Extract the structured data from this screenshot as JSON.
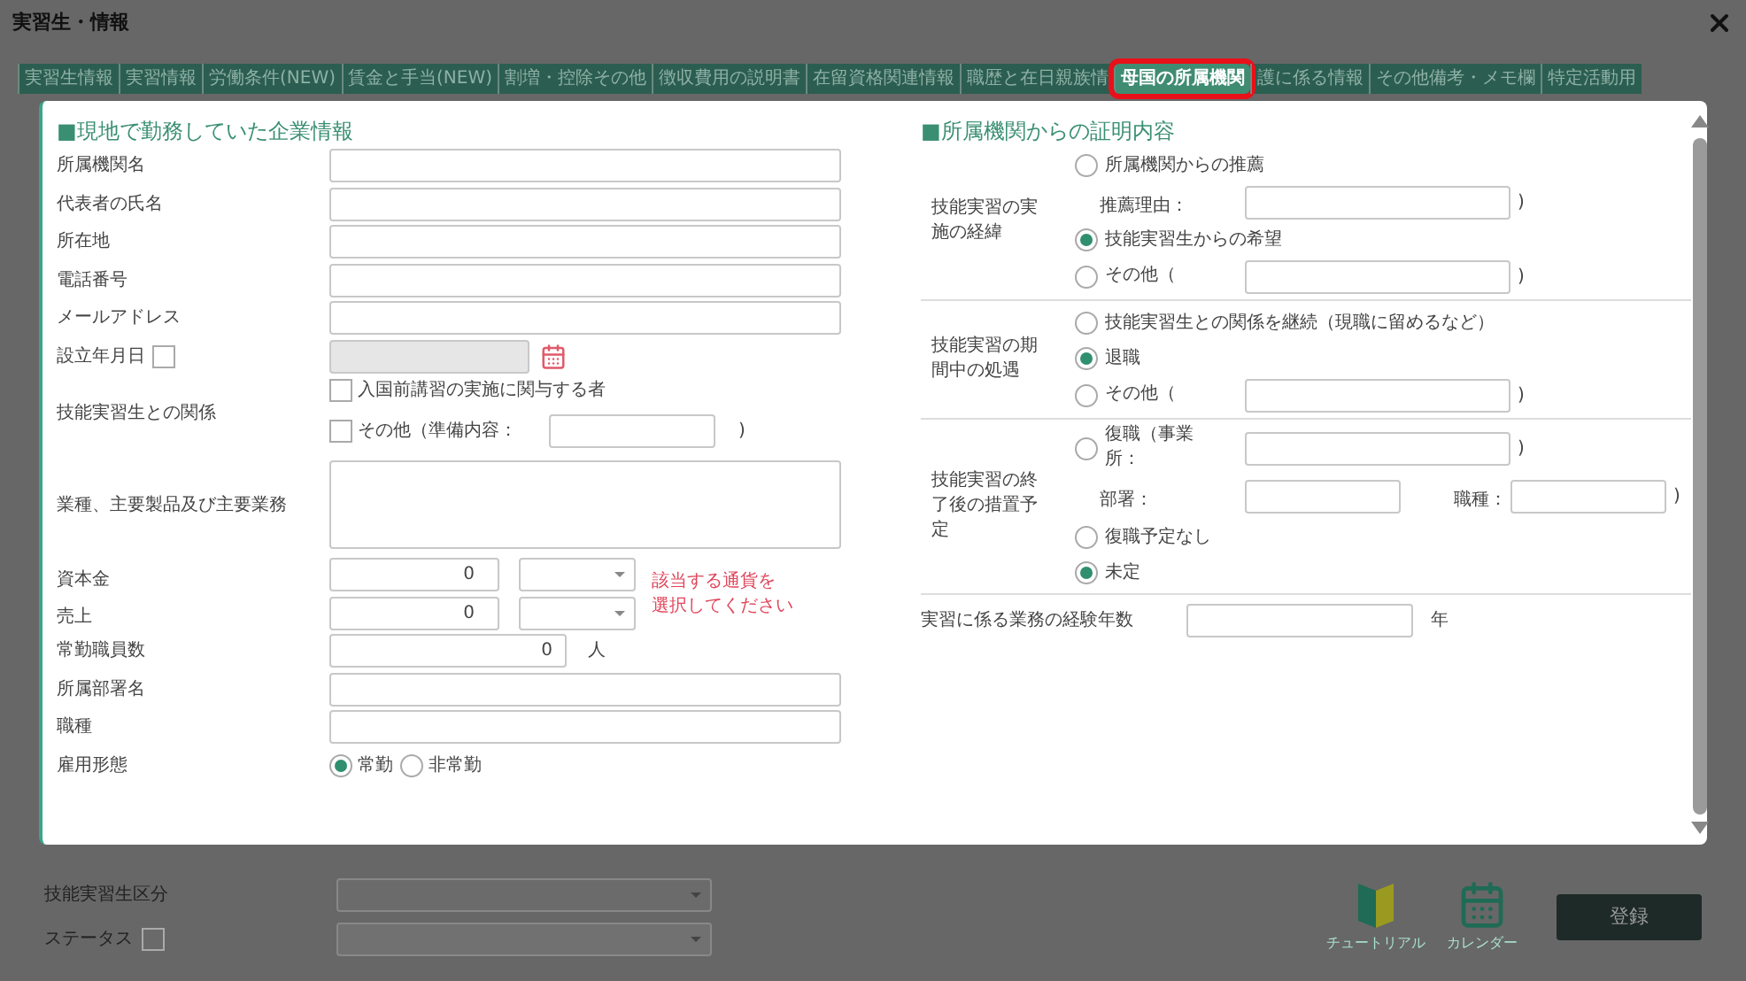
{
  "window": {
    "title": "実習生・情報"
  },
  "tabs": [
    {
      "label": "実習生情報",
      "selected": false
    },
    {
      "label": "実習情報",
      "selected": false
    },
    {
      "label": "労働条件(NEW)",
      "selected": false
    },
    {
      "label": "賃金と手当(NEW)",
      "selected": false
    },
    {
      "label": "割増・控除その他",
      "selected": false
    },
    {
      "label": "徴収費用の説明書",
      "selected": false
    },
    {
      "label": "在留資格関連情報",
      "selected": false
    },
    {
      "label": "職歴と在日親族情",
      "selected": false
    },
    {
      "label": "母国の所属機関",
      "selected": true
    },
    {
      "label": "護に係る情報",
      "selected": false
    },
    {
      "label": "その他備考・メモ欄",
      "selected": false
    },
    {
      "label": "特定活動用",
      "selected": false
    }
  ],
  "company": {
    "heading": "■現地で勤務していた企業情報",
    "rows": [
      {
        "kind": "text",
        "label": "所属機関名"
      },
      {
        "kind": "text",
        "label": "代表者の氏名"
      },
      {
        "kind": "text",
        "label": "所在地"
      },
      {
        "kind": "text",
        "label": "電話番号"
      },
      {
        "kind": "text",
        "label": "メールアドレス"
      },
      {
        "kind": "date",
        "label": "設立年月日",
        "checked": false
      },
      {
        "kind": "relation",
        "label": "技能実習生との関係",
        "options": [
          {
            "label": "入国前講習の実施に関与する者",
            "checked": false
          },
          {
            "label": "その他（準備内容：",
            "checked": false,
            "close": ")"
          }
        ]
      },
      {
        "kind": "textarea",
        "label": "業種、主要製品及び主要業務"
      },
      {
        "kind": "currency",
        "rows": [
          {
            "label": "資本金",
            "value": "0"
          },
          {
            "label": "売上",
            "value": "0"
          }
        ],
        "hint": [
          "該当する通貨を",
          "選択してください"
        ]
      },
      {
        "kind": "count",
        "label": "常勤職員数",
        "value": "0",
        "unit": "人"
      },
      {
        "kind": "text",
        "label": "所属部署名"
      },
      {
        "kind": "text",
        "label": "職種"
      },
      {
        "kind": "radio",
        "label": "雇用形態",
        "options": [
          {
            "label": "常勤",
            "selected": true
          },
          {
            "label": "非常勤",
            "selected": false
          }
        ]
      }
    ]
  },
  "certification": {
    "heading": "■所属機関からの証明内容",
    "groups": [
      {
        "label": "技能実習の実施の経緯",
        "items": [
          {
            "kind": "radio",
            "label": "所属機関からの推薦",
            "selected": false
          },
          {
            "kind": "field",
            "label": "推薦理由：",
            "close": ")"
          },
          {
            "kind": "radio",
            "label": "技能実習生からの希望",
            "selected": true
          },
          {
            "kind": "radio_field",
            "label": "その他（",
            "selected": false,
            "close": ")"
          }
        ]
      },
      {
        "label": "技能実習の期間中の処遇",
        "items": [
          {
            "kind": "radio",
            "label": "技能実習生との関係を継続（現職に留めるなど）",
            "selected": false
          },
          {
            "kind": "radio",
            "label": "退職",
            "selected": true
          },
          {
            "kind": "radio_field",
            "label": "その他（",
            "selected": false,
            "close": ")"
          }
        ]
      },
      {
        "label": "技能実習の終了後の措置予定",
        "items": [
          {
            "kind": "radio_field",
            "label": "復職（事業所：",
            "selected": false,
            "close": ")"
          },
          {
            "kind": "two_fields",
            "fields": [
              {
                "label": "部署："
              },
              {
                "label": "職種："
              }
            ],
            "close": ")"
          },
          {
            "kind": "radio",
            "label": "復職予定なし",
            "selected": false
          },
          {
            "kind": "radio",
            "label": "未定",
            "selected": true
          }
        ]
      }
    ],
    "experience": {
      "label": "実習に係る業務の経験年数",
      "unit": "年"
    }
  },
  "footer": {
    "category_label": "技能実習生区分",
    "status": {
      "label": "ステータス",
      "checked": false
    },
    "tools": [
      {
        "kind": "tutorial",
        "label": "チュートリアル"
      },
      {
        "kind": "calendar",
        "label": "カレンダー"
      }
    ],
    "register_button": "登録"
  }
}
